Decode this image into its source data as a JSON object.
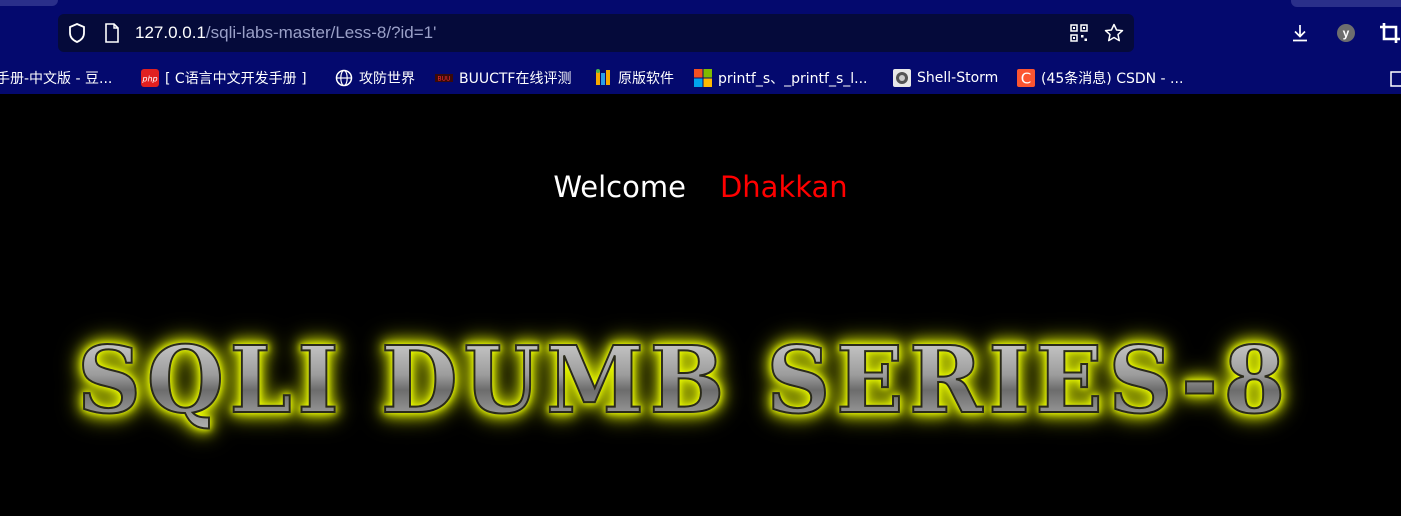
{
  "browser": {
    "url_host": "127.0.0.1",
    "url_path": "/sqli-labs-master/Less-8/?id=1'",
    "avatar_letter": "y",
    "icons": {
      "security": "shield-icon",
      "page": "page-icon",
      "qr": "qr-code-icon",
      "star": "star-icon",
      "download": "download-icon",
      "crop": "crop-icon",
      "folder": "folder-icon"
    }
  },
  "bookmarks": [
    {
      "label": "手册-中文版 - 豆...",
      "icon": "none"
    },
    {
      "label": "[ C语言中文开发手册 ]",
      "icon": "php-icon"
    },
    {
      "label": "攻防世界",
      "icon": "globe-icon"
    },
    {
      "label": "BUUCTF在线评测",
      "icon": "buuctf-icon"
    },
    {
      "label": "原版软件",
      "icon": "itellyou-icon"
    },
    {
      "label": "printf_s、_printf_s_l...",
      "icon": "microsoft-icon"
    },
    {
      "label": "Shell-Storm",
      "icon": "shellstorm-icon"
    },
    {
      "label": "(45条消息) CSDN - ...",
      "icon": "csdn-icon"
    }
  ],
  "page": {
    "welcome_label": "Welcome",
    "welcome_name": "Dhakkan",
    "banner_text": "SQLI DUMB SERIES-8",
    "colors": {
      "background": "#000000",
      "chrome": "#04096e",
      "welcome": "#ffffff",
      "name": "#ff0000",
      "banner_glow": "#f0ff00"
    }
  }
}
